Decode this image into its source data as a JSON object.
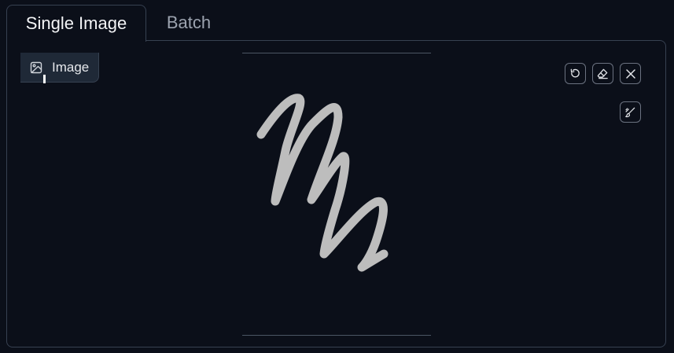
{
  "tabs": [
    {
      "label": "Single Image",
      "active": true
    },
    {
      "label": "Batch",
      "active": false
    }
  ],
  "image_block": {
    "label": "Image",
    "icon": "image-icon"
  },
  "toolbar": {
    "undo_icon": "undo-icon",
    "eraser_icon": "eraser-icon",
    "clear_icon": "close-icon",
    "brush_icon": "brush-icon"
  },
  "colors": {
    "background": "#0b0f19",
    "border": "#374151",
    "stroke": "#bdbdbd",
    "text_active": "#f3f4f6",
    "text_inactive": "#9ca3af"
  }
}
